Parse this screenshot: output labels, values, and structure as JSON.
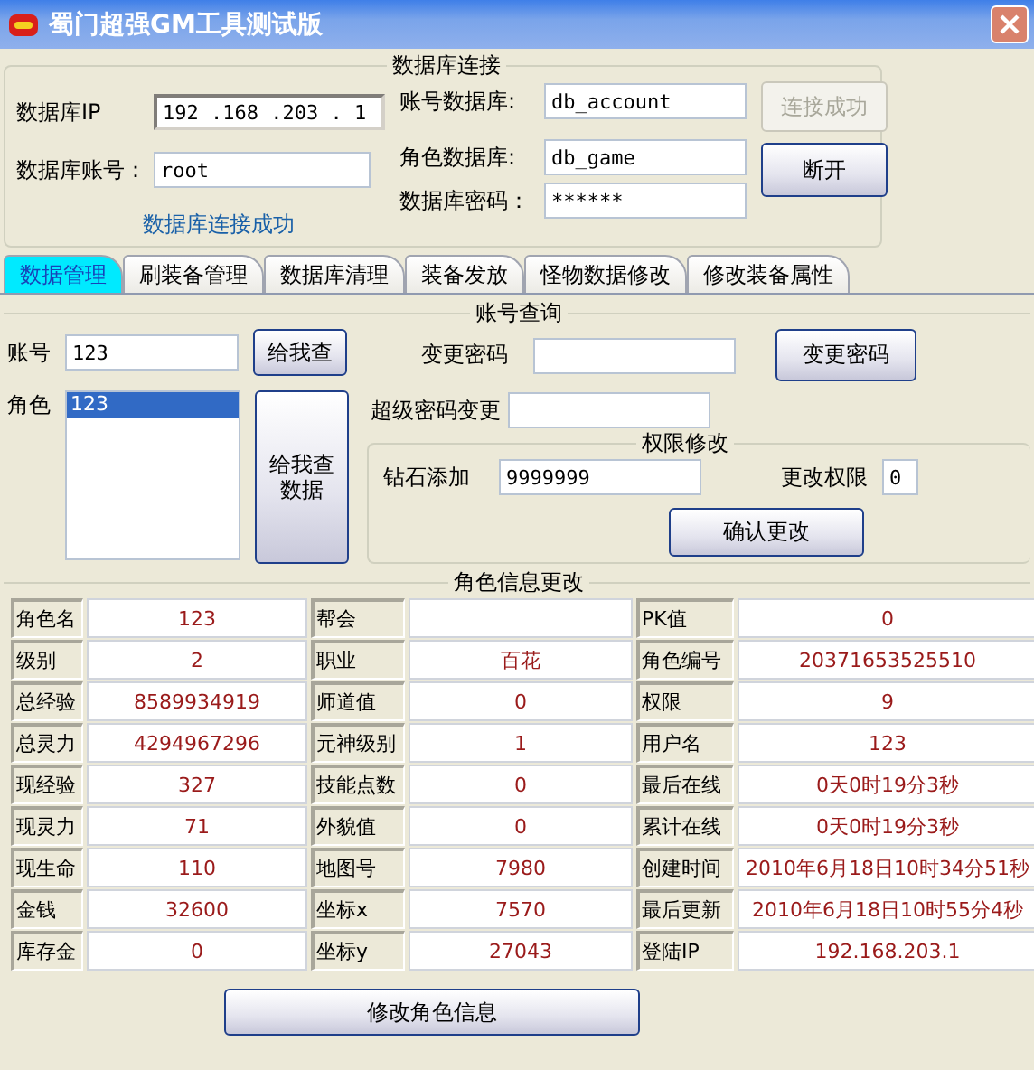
{
  "title": "蜀门超强GM工具测试版",
  "db_connection": {
    "title": "数据库连接",
    "ip": {
      "label": "数据库IP",
      "value": "192 .168 .203 . 1"
    },
    "account": {
      "label": "数据库账号：",
      "value": "root"
    },
    "status": "数据库连接成功",
    "account_db": {
      "label": "账号数据库:",
      "value": "db_account"
    },
    "role_db": {
      "label": "角色数据库:",
      "value": "db_game"
    },
    "password": {
      "label": "数据库密码：",
      "value": "******"
    },
    "connect_button": {
      "label": "连接成功",
      "disabled": true
    },
    "disconnect_button": {
      "label": "断开",
      "disabled": false
    }
  },
  "tabs": [
    {
      "label": "数据管理",
      "selected": true
    },
    {
      "label": "刷装备管理",
      "selected": false
    },
    {
      "label": "数据库清理",
      "selected": false
    },
    {
      "label": "装备发放",
      "selected": false
    },
    {
      "label": "怪物数据修改",
      "selected": false
    },
    {
      "label": "修改装备属性",
      "selected": false
    }
  ],
  "account_query": {
    "title": "账号查询",
    "account": {
      "label": "账号",
      "value": "123"
    },
    "query_button": "给我查",
    "roles": {
      "label": "角色",
      "items": [
        {
          "text": "123",
          "selected": true
        }
      ]
    },
    "query_data_button": "给我查数据",
    "change_password": {
      "label": "变更密码"
    },
    "change_password_button": "变更密码",
    "super_password": {
      "label": "超级密码变更"
    },
    "permissions": {
      "title": "权限修改",
      "diamond": {
        "label": "钻石添加",
        "value": "9999999"
      },
      "permission": {
        "label": "更改权限",
        "value": "0"
      },
      "confirm_button": "确认更改"
    }
  },
  "role_info": {
    "title": "角色信息更改",
    "rows": [
      [
        {
          "label": "角色名",
          "value": "123"
        },
        {
          "label": "帮会"
        },
        {
          "label": "PK值",
          "value": "0"
        }
      ],
      [
        {
          "label": "级别",
          "value": "2"
        },
        {
          "label": "职业",
          "value": "百花"
        },
        {
          "label": "角色编号",
          "value": "20371653525510"
        }
      ],
      [
        {
          "label": "总经验",
          "value": "8589934919"
        },
        {
          "label": "师道值",
          "value": "0"
        },
        {
          "label": "权限",
          "value": "9"
        }
      ],
      [
        {
          "label": "总灵力",
          "value": "4294967296"
        },
        {
          "label": "元神级别",
          "value": "1"
        },
        {
          "label": "用户名",
          "value": "123"
        }
      ],
      [
        {
          "label": "现经验",
          "value": "327"
        },
        {
          "label": "技能点数",
          "value": "0"
        },
        {
          "label": "最后在线",
          "value": "0天0时19分3秒"
        }
      ],
      [
        {
          "label": "现灵力",
          "value": "71"
        },
        {
          "label": "外貌值",
          "value": "0"
        },
        {
          "label": "累计在线",
          "value": "0天0时19分3秒"
        }
      ],
      [
        {
          "label": "现生命",
          "value": "110"
        },
        {
          "label": "地图号",
          "value": "7980"
        },
        {
          "label": "创建时间",
          "value": "2010年6月18日10时34分51秒"
        }
      ],
      [
        {
          "label": "金钱",
          "value": "32600"
        },
        {
          "label": "坐标x",
          "value": "7570"
        },
        {
          "label": "最后更新",
          "value": "2010年6月18日10时55分4秒"
        }
      ],
      [
        {
          "label": "库存金",
          "value": "0"
        },
        {
          "label": "坐标y",
          "value": "27043"
        },
        {
          "label": "登陆IP",
          "value": "192.168.203.1"
        }
      ]
    ],
    "submit_button": "修改角色信息"
  }
}
